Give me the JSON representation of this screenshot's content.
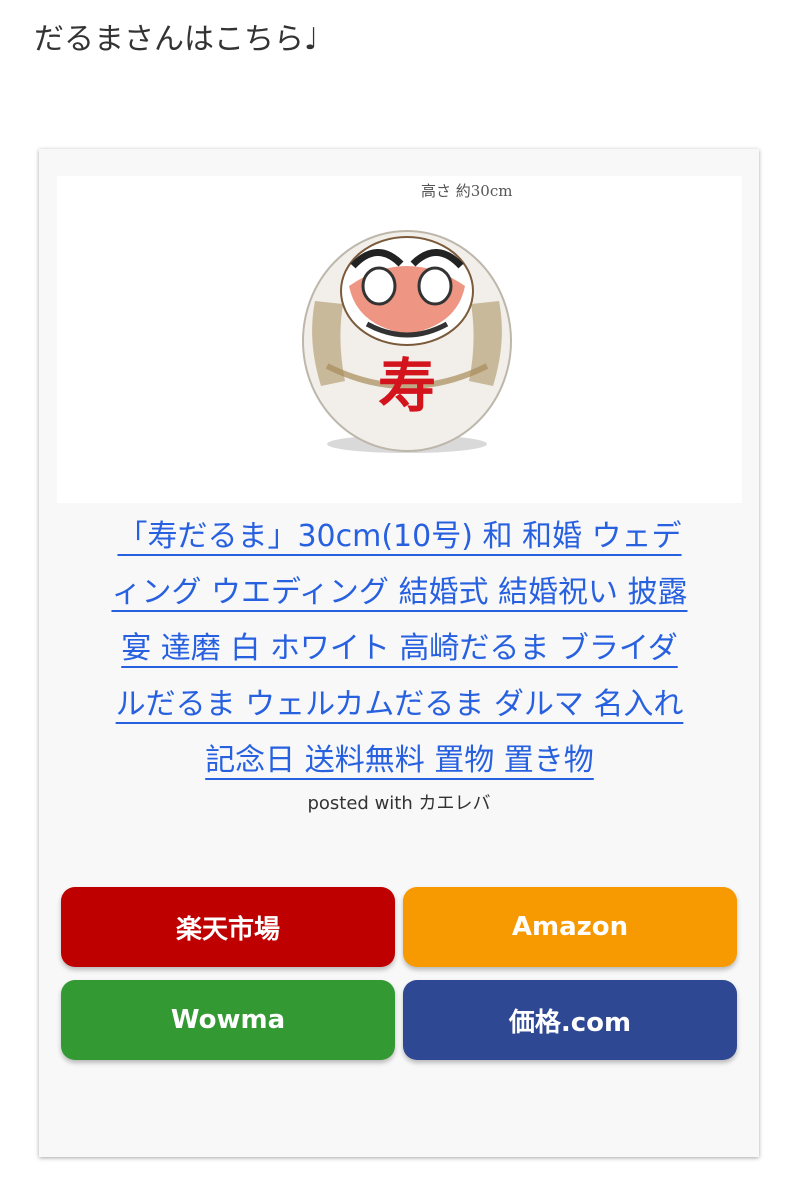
{
  "intro_text": "だるまさんはこちら♩",
  "product": {
    "image_height_label": "高さ 約30cm",
    "daruma_character": "寿",
    "title_lines": [
      "「寿だるま」30cm(10号) 和 和婚 ウェデ",
      "ィング ウエディング 結婚式 結婚祝い 披露",
      "宴 達磨 白 ホワイト 高崎だるま ブライダ",
      "ルだるま ウェルカムだるま ダルマ 名入れ",
      "記念日 送料無料 置物 置き物"
    ],
    "posted_with": "posted with カエレバ"
  },
  "buttons": {
    "rakuten": "楽天市場",
    "amazon": "Amazon",
    "wowma": "Wowma",
    "kakaku": "価格.com"
  },
  "colors": {
    "link": "#2861e0",
    "rakuten": "#bf0000",
    "amazon": "#f79900",
    "wowma": "#339933",
    "kakaku": "#2f4893",
    "card_background": "#f8f8f8"
  }
}
